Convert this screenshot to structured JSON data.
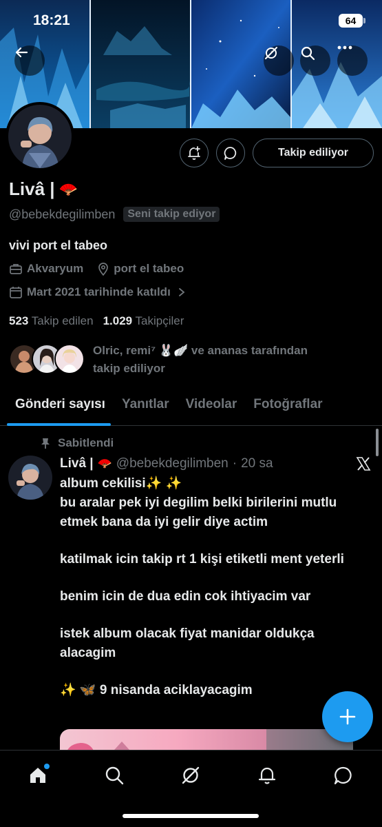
{
  "status_bar": {
    "time": "18:21",
    "battery": "64"
  },
  "profile": {
    "display_name": "Livâ |",
    "name_emoji": "🪭",
    "handle": "@bebekdegilimben",
    "follows_you_badge": "Seni takip ediyor",
    "bio": "vivi port el tabeo",
    "category": "Akvaryum",
    "location": "port el tabeo",
    "joined": "Mart 2021 tarihinde katıldı",
    "following_count": "523",
    "following_label": "Takip edilen",
    "followers_count": "1.029",
    "followers_label": "Takipçiler",
    "followed_by_line1": "Olric, remi⁷ 🐰🪽 ve ananas tarafından",
    "followed_by_line2": "takip ediliyor",
    "follow_button": "Takip ediliyor"
  },
  "tabs": [
    {
      "label": "Gönderi sayısı",
      "active": true
    },
    {
      "label": "Yanıtlar",
      "active": false
    },
    {
      "label": "Videolar",
      "active": false
    },
    {
      "label": "Fotoğraflar",
      "active": false
    }
  ],
  "tweet": {
    "pinned_label": "Sabitlendi",
    "author_name": "Livâ |",
    "author_emoji": "🪭",
    "author_handle": "@bebekdegilimben",
    "separator": "·",
    "time": "20 sa",
    "line1": "album cekilisi✨ ✨",
    "para1": "bu aralar pek iyi degilim belki birilerini mutlu etmek bana da iyi gelir diye actim",
    "para2": "katilmak icin takip rt 1 kişi etiketli ment yeterli",
    "para3": "benim icin de dua edin cok ihtiyacim var",
    "para4": "istek album olacak fiyat manidar oldukça alacagim",
    "para5": "✨ 🦋 9 nisanda aciklayacagim"
  },
  "icons": {
    "back": "back-arrow-icon",
    "grok": "grok-icon",
    "search": "search-icon",
    "more": "more-icon",
    "notify": "bell-plus-icon",
    "message": "message-icon",
    "compose": "plus-icon",
    "nav": [
      "home-icon",
      "search-icon",
      "grok-icon",
      "bell-icon",
      "message-icon"
    ]
  },
  "colors": {
    "accent": "#1d9bf0",
    "muted": "#71767b",
    "text": "#e7e9ea",
    "background": "#000000"
  }
}
